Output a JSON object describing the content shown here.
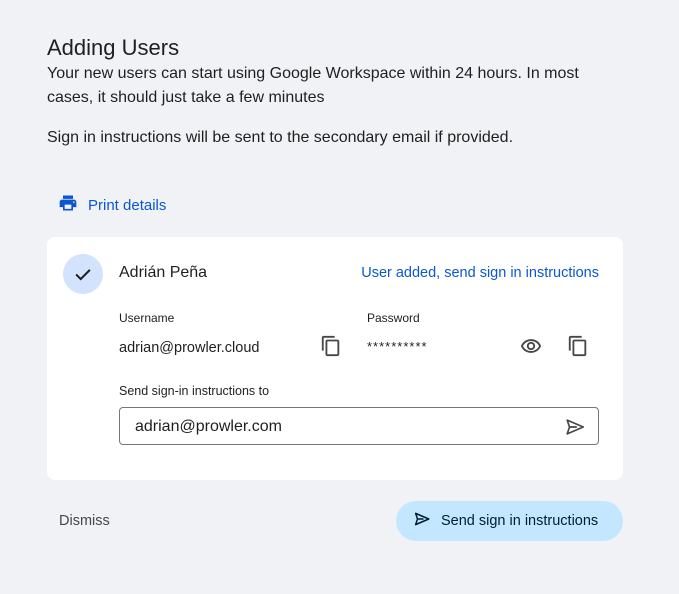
{
  "header": {
    "title": "Adding Users",
    "description": "Your new users can start using Google Workspace within 24 hours. In most cases, it should just take a few minutes",
    "note": "Sign in instructions will be sent to the secondary email if provided."
  },
  "print": {
    "label": "Print details",
    "icon": "printer-icon"
  },
  "user_card": {
    "name": "Adrián Peña",
    "status_link": "User added, send sign in instructions",
    "username_label": "Username",
    "username_value": "adrian@prowler.cloud",
    "password_label": "Password",
    "password_value": "**********",
    "send_to_label": "Send sign-in instructions to",
    "send_to_value": "adrian@prowler.com"
  },
  "footer": {
    "dismiss_label": "Dismiss",
    "send_button_label": "Send sign in instructions"
  },
  "colors": {
    "background": "#f0f2f5",
    "link": "#0b57d0",
    "check_circle": "#d3e3fd",
    "primary_button": "#c2e7ff"
  }
}
